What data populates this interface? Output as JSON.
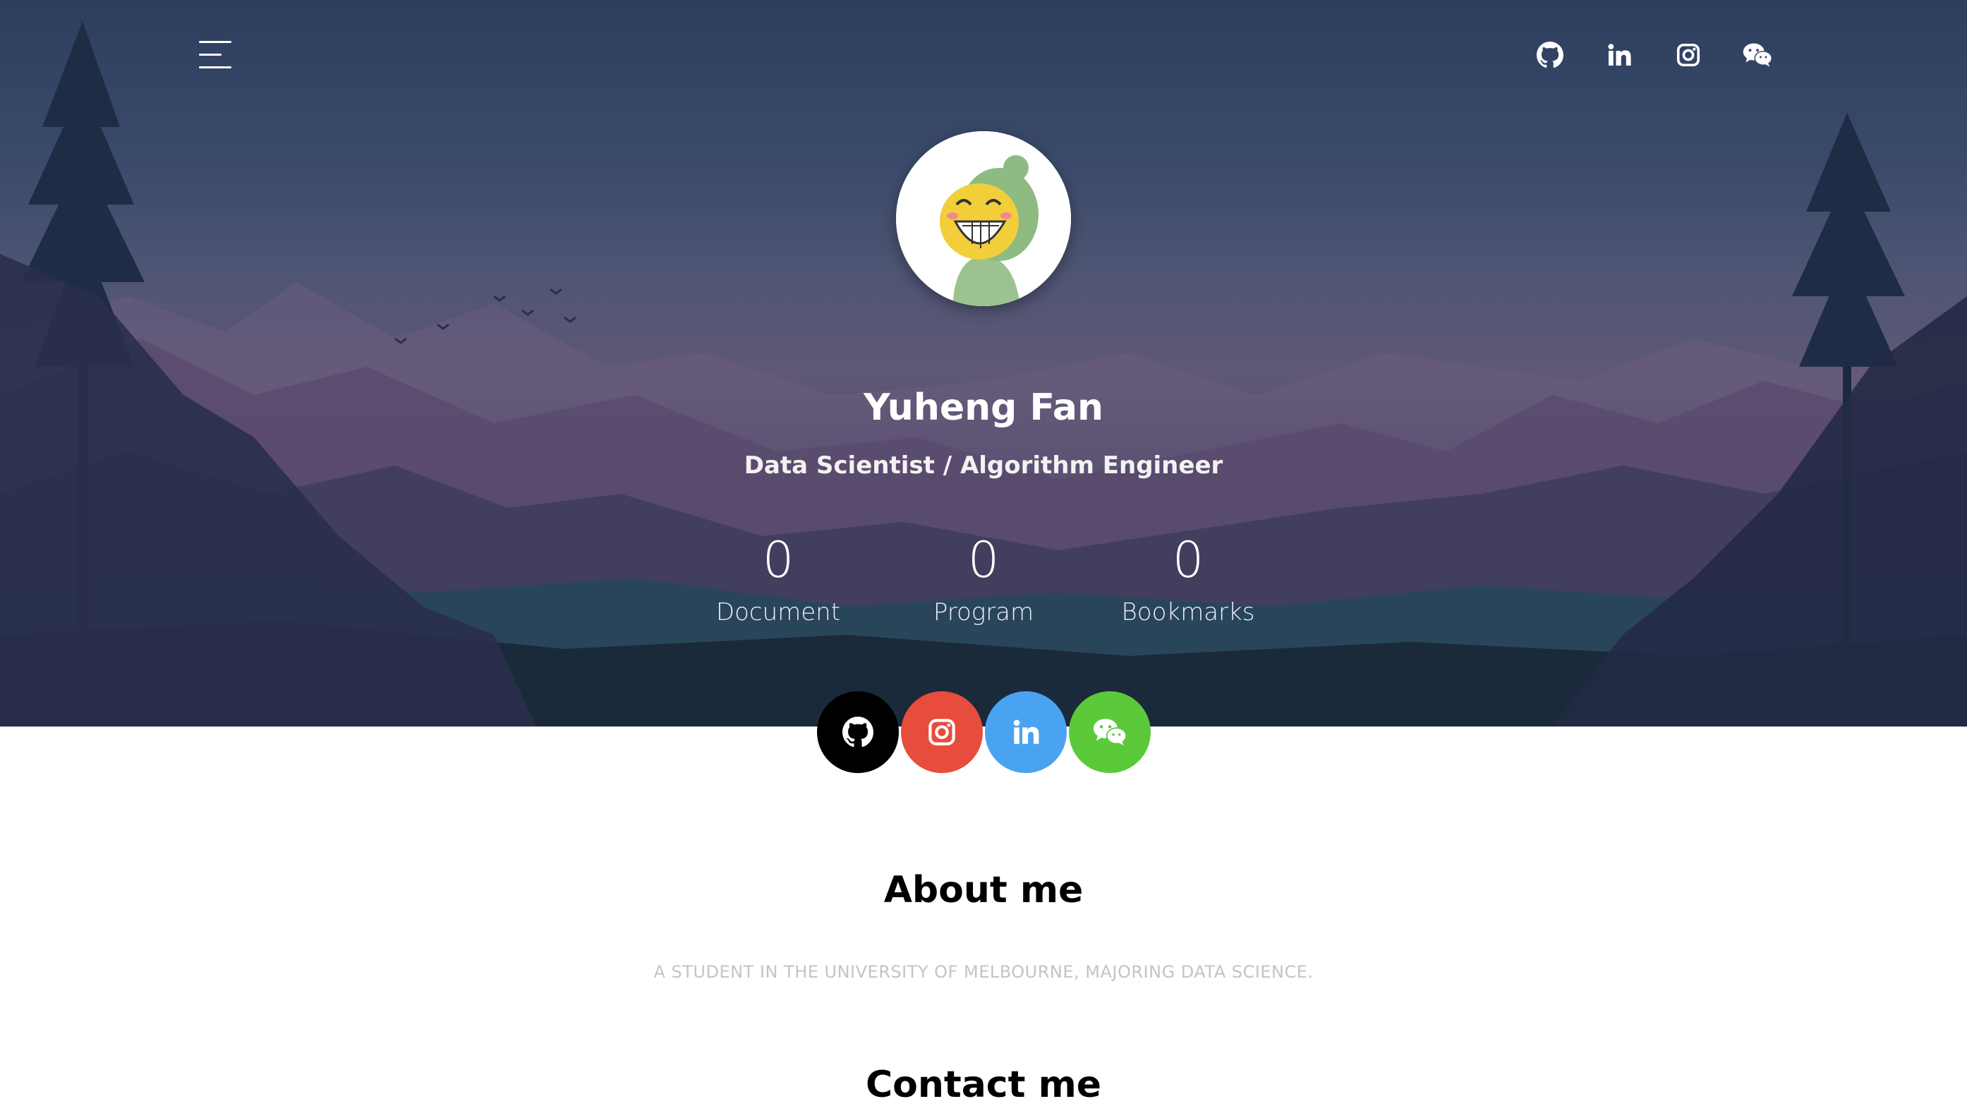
{
  "nav": {
    "top_icons": [
      "github-icon",
      "linkedin-icon",
      "instagram-icon",
      "wechat-icon"
    ]
  },
  "profile": {
    "name": "Yuheng Fan",
    "title": "Data Scientist / Algorithm Engineer"
  },
  "stats": [
    {
      "value": "0",
      "label": "Document"
    },
    {
      "value": "0",
      "label": "Program"
    },
    {
      "value": "0",
      "label": "Bookmarks"
    }
  ],
  "social_buttons": [
    {
      "icon": "github-icon",
      "color": "#000000"
    },
    {
      "icon": "instagram-icon",
      "color": "#e74c3c"
    },
    {
      "icon": "linkedin-icon",
      "color": "#4aa3f0"
    },
    {
      "icon": "wechat-icon",
      "color": "#5cc93b"
    }
  ],
  "about": {
    "title": "About me",
    "text": "A STUDENT IN THE UNIVERSITY OF MELBOURNE, MAJORING DATA SCIENCE."
  },
  "contact": {
    "title": "Contact me"
  }
}
